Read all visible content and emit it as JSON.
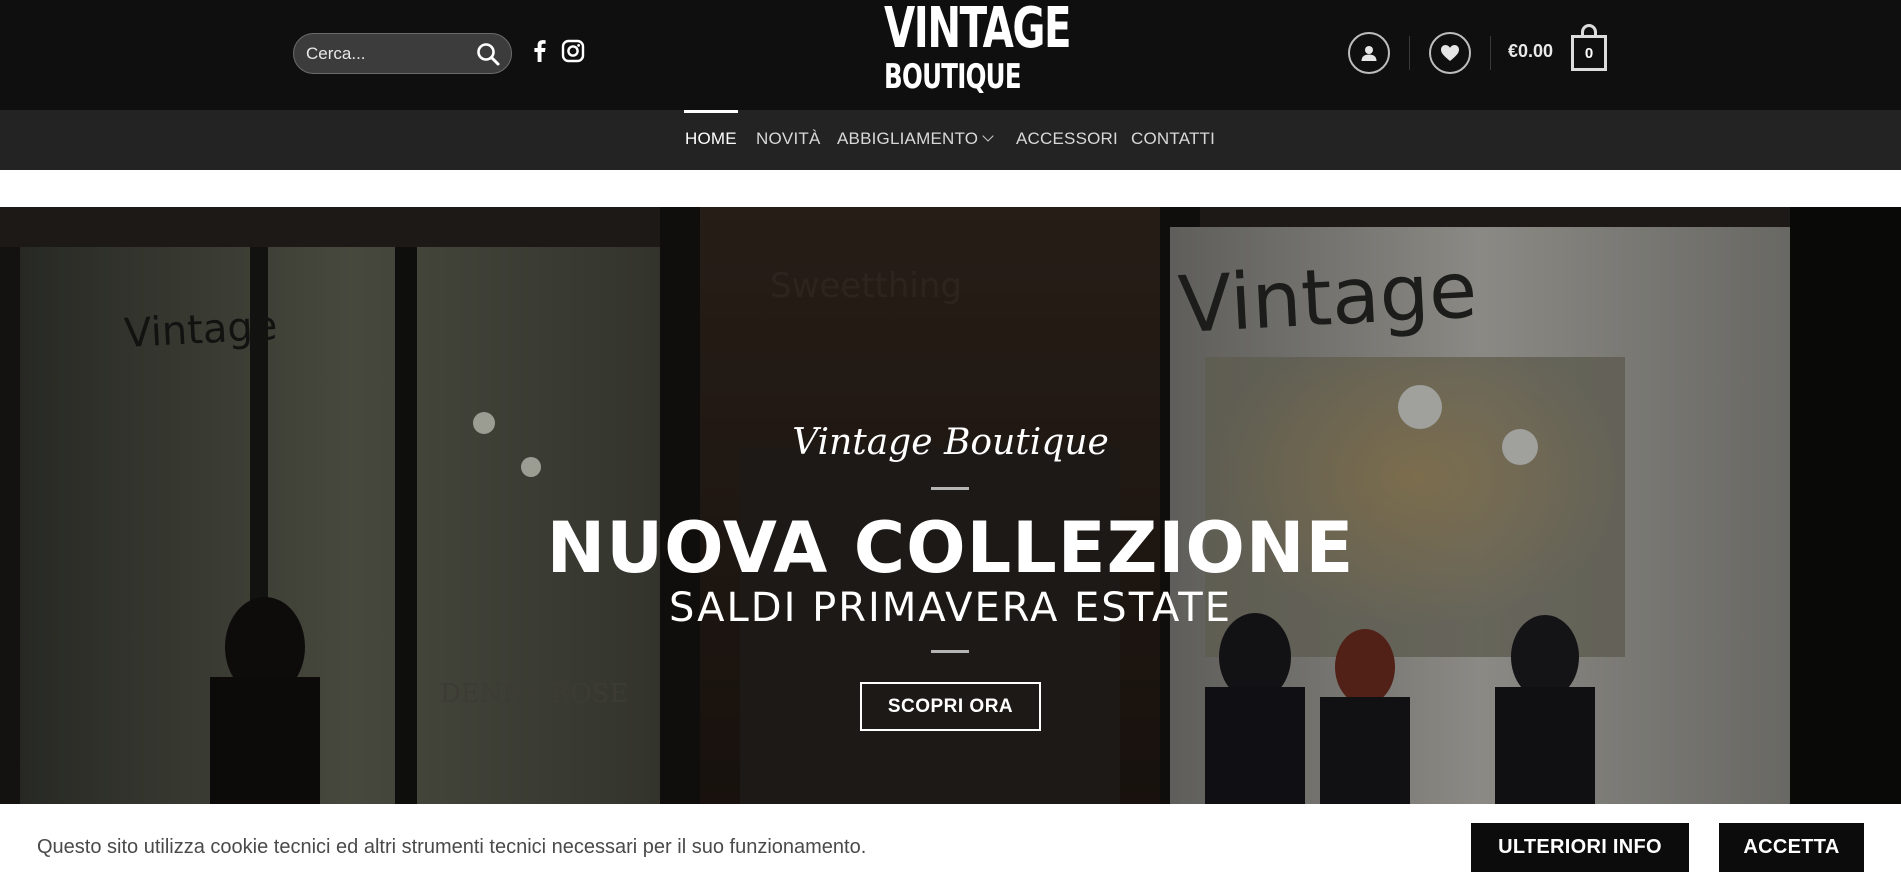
{
  "header": {
    "search": {
      "placeholder": "Cerca..."
    },
    "logo": {
      "line1": "VINTAGE",
      "line2": "BOUTIQUE"
    },
    "social_icons": [
      "facebook-icon",
      "instagram-icon"
    ],
    "account_icon": "user-icon",
    "wishlist_icon": "heart-icon",
    "cart": {
      "total": "€0.00",
      "count": "0"
    }
  },
  "nav": {
    "items": [
      {
        "label": "HOME",
        "active": true
      },
      {
        "label": "NOVITÀ"
      },
      {
        "label": "ABBIGLIAMENTO",
        "has_dropdown": true
      },
      {
        "label": "ACCESSORI"
      },
      {
        "label": "CONTATTI"
      }
    ]
  },
  "hero": {
    "script_title": "Vintage Boutique",
    "title": "NUOVA COLLEZIONE",
    "subtitle": "SALDI PRIMAVERA ESTATE",
    "cta": "SCOPRI ORA",
    "background_text": {
      "sign_left": "Vintage",
      "sign_right": "Vintage",
      "sign_center": "Sweetthing",
      "brand": "DENNY ROSE"
    }
  },
  "cookie_bar": {
    "text": "Questo sito utilizza cookie tecnici ed altri strumenti tecnici necessari per il suo funzionamento.",
    "more_info": "ULTERIORI INFO",
    "accept": "ACCETTA"
  },
  "colors": {
    "header_bg": "#0f0f0f",
    "nav_bg": "#232323",
    "button_bg": "#0c0c0c",
    "text_light": "#ffffff"
  }
}
